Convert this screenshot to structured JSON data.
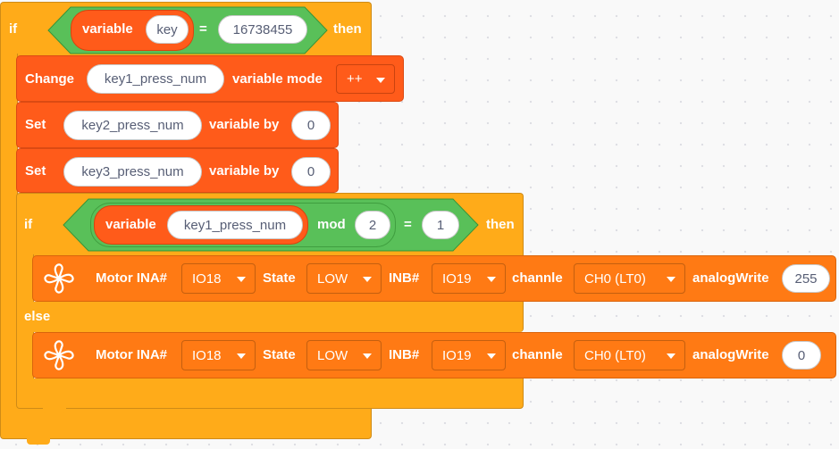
{
  "outer_if": {
    "if_label": "if",
    "condition": {
      "variable_label": "variable",
      "variable_name": "key",
      "operator": "=",
      "value": "16738455"
    },
    "then_label": "then"
  },
  "change_block": {
    "label": "Change",
    "variable_name": "key1_press_num",
    "mode_label": "variable mode",
    "mode_value": "++"
  },
  "set_block_1": {
    "label": "Set",
    "variable_name": "key2_press_num",
    "by_label": "variable by",
    "value": "0"
  },
  "set_block_2": {
    "label": "Set",
    "variable_name": "key3_press_num",
    "by_label": "variable by",
    "value": "0"
  },
  "inner_if": {
    "if_label": "if",
    "condition": {
      "variable_label": "variable",
      "variable_name": "key1_press_num",
      "mod_label": "mod",
      "mod_value": "2",
      "operator": "=",
      "value": "1"
    },
    "then_label": "then",
    "else_label": "else"
  },
  "motor_block_1": {
    "icon": "fan-icon",
    "ina_label": "Motor INA#",
    "ina_value": "IO18",
    "state_label": "State",
    "state_value": "LOW",
    "inb_label": "INB#",
    "inb_value": "IO19",
    "channel_label": "channle",
    "channel_value": "CH0 (LT0)",
    "write_label": "analogWrite",
    "write_value": "255"
  },
  "motor_block_2": {
    "icon": "fan-icon",
    "ina_label": "Motor INA#",
    "ina_value": "IO18",
    "state_label": "State",
    "state_value": "LOW",
    "inb_label": "INB#",
    "inb_value": "IO19",
    "channel_label": "channle",
    "channel_value": "CH0 (LT0)",
    "write_label": "analogWrite",
    "write_value": "0"
  },
  "colors": {
    "control": "#ffab19",
    "operator": "#59c059",
    "variable": "#ff5b1a",
    "motor": "#ff7a14",
    "canvas": "#f9f9f9"
  }
}
